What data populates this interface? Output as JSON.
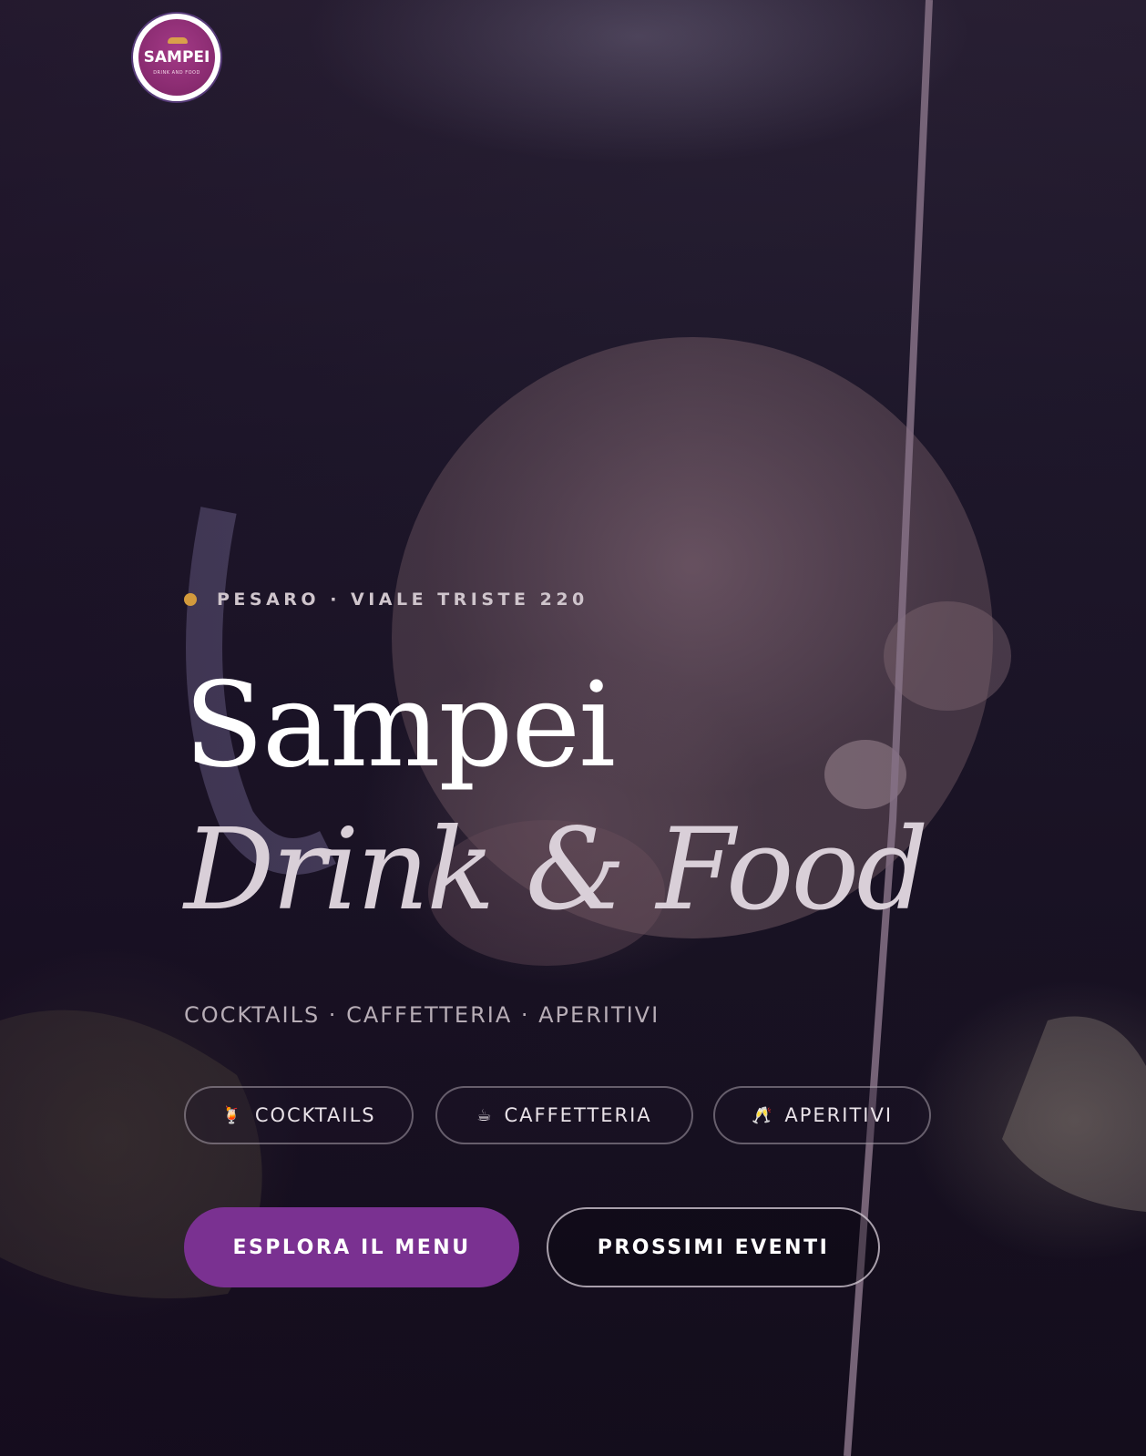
{
  "header": {
    "logo": {
      "name": "SAMPEI",
      "sub": "DRINK AND FOOD",
      "icon": "hat-icon"
    }
  },
  "hero": {
    "location": "PESARO · VIALE TRISTE 220",
    "title_line1": "Sampei",
    "title_line2": "Drink & Food",
    "tagline": "COCKTAILS · CAFFETTERIA · APERITIVI",
    "chips": [
      {
        "icon": "🍹",
        "label": "COCKTAILS"
      },
      {
        "icon": "☕",
        "label": "CAFFETTERIA"
      },
      {
        "icon": "🥂",
        "label": "APERITIVI"
      }
    ],
    "primary_button": "ESPLORA IL MENU",
    "secondary_button": "PROSSIMI EVENTI"
  },
  "colors": {
    "accent_purple": "#7a3191",
    "accent_gold": "#d39a3c",
    "logo_magenta": "#8e2e74"
  }
}
